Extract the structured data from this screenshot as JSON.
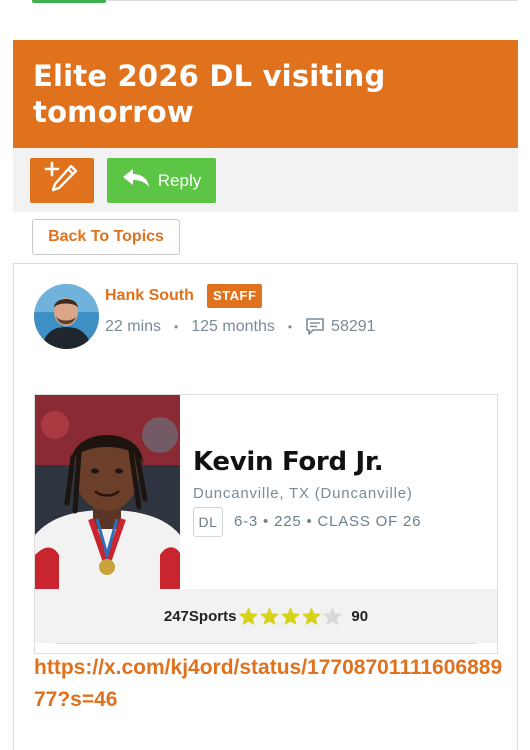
{
  "thread": {
    "title": "Elite 2026 DL visiting tomorrow"
  },
  "actions": {
    "reply_label": "Reply",
    "back_label": "Back To Topics"
  },
  "post": {
    "author": "Hank South",
    "badge": "STAFF",
    "time_ago": "22 mins",
    "member_duration": "125 months",
    "post_count": "58291",
    "link": "https://x.com/kj4ord/status/1770870111160688977?s=46"
  },
  "player": {
    "name": "Kevin Ford Jr.",
    "hometown": "Duncanville, TX (Duncanville)",
    "position": "DL",
    "stats": "6-3 • 225 • CLASS OF 26",
    "rating_source": "247Sports",
    "stars_filled": 4,
    "stars_total": 5,
    "rating": "90"
  },
  "colors": {
    "brand_orange": "#e0721e",
    "reply_green": "#5cc545",
    "meta_gray": "#7a8b97",
    "star_yellow": "#d6d21a",
    "star_empty": "#d8d8d8"
  },
  "icons": {
    "edit": "pencil-plus-icon",
    "reply": "reply-arrow-icon",
    "posts": "chat-bubble-icon",
    "star": "star-icon"
  }
}
